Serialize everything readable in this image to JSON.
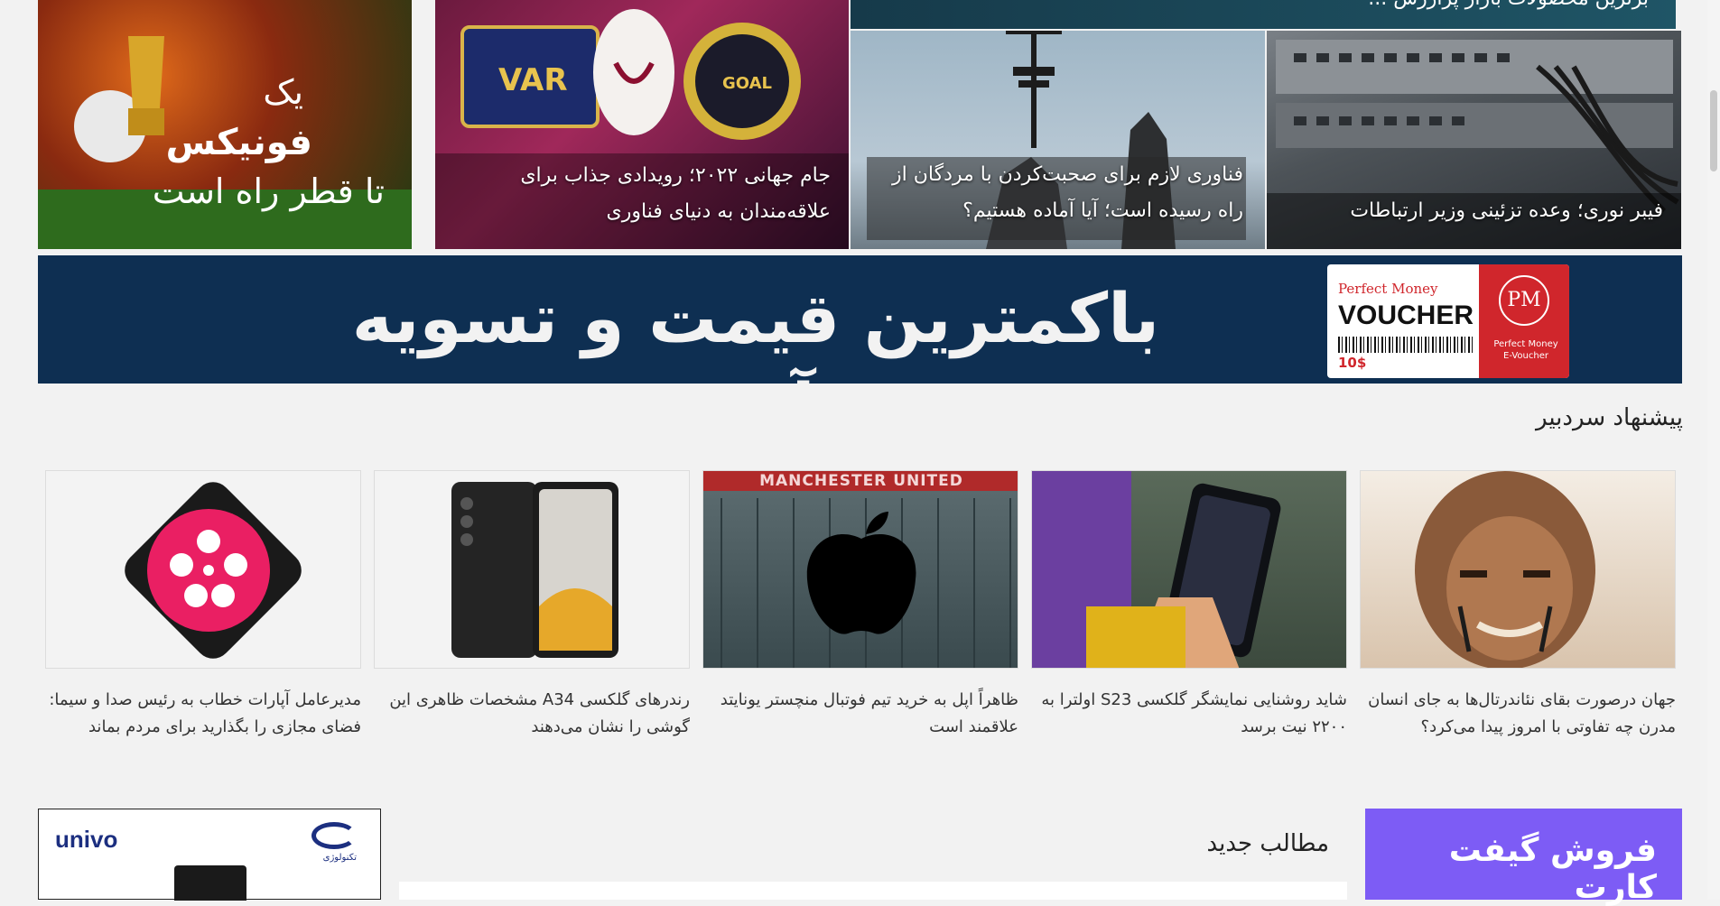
{
  "top_tiles": [
    {
      "caption": "فیبر نوری؛ وعده تزئینی وزیر ارتباطات"
    },
    {
      "caption": "فناوری لازم برای صحبت‌کردن با مردگان از راه رسیده است؛ آیا آماده هستیم؟"
    },
    {
      "caption": "جام جهانی ۲۰۲۲؛ رویدادی جذاب برای علاقه‌مندان به دنیای فناوری"
    },
    {
      "ad_lines": [
        "یک",
        "فونیکس",
        "تا قطر راه است"
      ]
    }
  ],
  "top_cut_caption": "برترین محصولات بازار پرارزش ...",
  "banner": {
    "headline": "باکمترین قیمت و تسویه آنی",
    "brand_top": "Perfect Money",
    "brand_main": "VOUCHER",
    "brand_price": "10$",
    "brand_badge": "PM",
    "brand_sub": "Perfect Money E-Voucher"
  },
  "editor_pick": {
    "title": "پیشنهاد سردبیر",
    "cards": [
      {
        "text": "جهان درصورت بقای نئاندرتال‌ها به جای انسان مدرن چه تفاوتی با امروز پیدا می‌کرد؟",
        "icon": "neanderthal-image"
      },
      {
        "text": "شاید روشنایی نمایشگر گلکسی S23 اولترا به ۲۲۰۰ نیت برسد",
        "icon": "phone-hand-image"
      },
      {
        "text": "ظاهراً اپل به خرید تیم فوتبال منچستر یونایتد علاقمند است",
        "icon": "apple-stadium-image"
      },
      {
        "text": "رندرهای گلکسی A34 مشخصات ظاهری این گوشی را نشان می‌دهند",
        "icon": "galaxy-phone-image"
      },
      {
        "text": "مدیرعامل آپارات خطاب به رئیس صدا و سیما: فضای مجازی را بگذارید برای مردم بماند",
        "icon": "aparat-logo-image"
      }
    ],
    "stadium_sign": "MANCHESTER UNITED"
  },
  "new_posts_title": "مطالب جدید",
  "gift_ad": {
    "text": "فروش گیفت کارت"
  },
  "univo_ad": {
    "brand": "univo",
    "partner": "تکنولوژی"
  },
  "colors": {
    "banner_bg": "#0e2f52",
    "gift_bg": "#7d5cf5",
    "pm_red": "#d0262c"
  }
}
